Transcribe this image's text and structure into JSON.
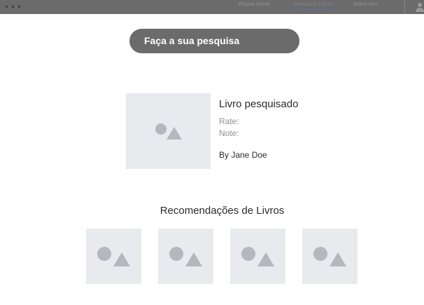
{
  "nav": {
    "links": [
      {
        "label": "Página Inicial"
      },
      {
        "label": "Pesquisar Livros"
      },
      {
        "label": "Sobre nós"
      }
    ],
    "active_index": 1
  },
  "search": {
    "label": "Faça a sua pesquisa"
  },
  "book": {
    "title": "Livro pesquisado",
    "rate_label": "Rate:",
    "note_label": "Note:",
    "author": "By Jane Doe"
  },
  "recommendations": {
    "title": "Recomendações de Livros",
    "count": 4
  },
  "colors": {
    "topbar": "#6b6b6b",
    "placeholder_bg": "#e9eaee",
    "placeholder_icon": "#b5b7bf",
    "active_underline": "#5a6fb0"
  },
  "icons": {
    "image_placeholder": "image-placeholder-icon",
    "user": "user-icon",
    "window_dots": "more-dots-icon"
  }
}
